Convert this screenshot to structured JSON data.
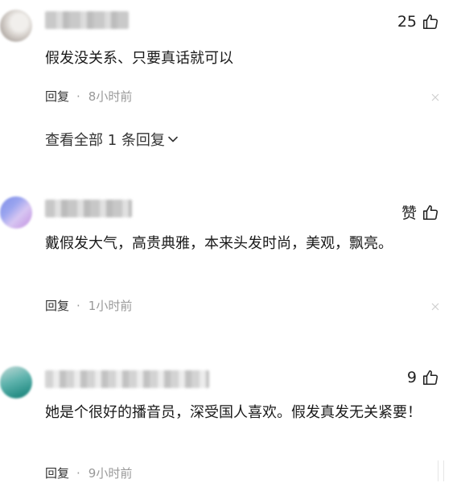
{
  "comments": [
    {
      "likes": "25",
      "text": "假发没关系、只要真话就可以",
      "reply_label": "回复",
      "separator": "·",
      "time": "8小时前",
      "view_all_replies": "查看全部 1 条回复"
    },
    {
      "likes": "赞",
      "text": "戴假发大气，高贵典雅，本来头发时尚，美观，飘亮。",
      "reply_label": "回复",
      "separator": "·",
      "time": "1小时前"
    },
    {
      "likes": "9",
      "text": "她是个很好的播音员，深受国人喜欢。假发真发无关紧要！",
      "reply_label": "回复",
      "separator": "·",
      "time": "9小时前"
    }
  ],
  "icons": {
    "like": "thumbs-up-icon",
    "close": "close-icon",
    "expand": "chevron-down-icon"
  },
  "colors": {
    "text": "#1a1a1a",
    "meta": "#999999"
  }
}
